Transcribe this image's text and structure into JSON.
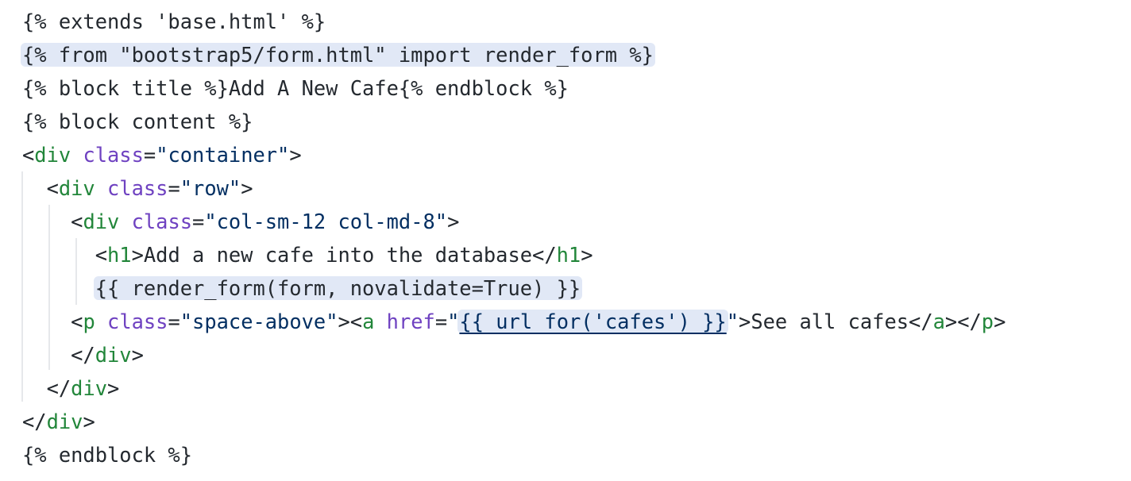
{
  "editor": {
    "colors": {
      "background": "#ffffff",
      "default_text": "#24292f",
      "tag": "#22863a",
      "attribute": "#6f42c1",
      "string": "#032f62",
      "highlight_background": "#e1e8f6",
      "indent_guide": "#e6e8eb"
    },
    "lines": [
      {
        "tokens": [
          {
            "text": "{% extends 'base.html' %}",
            "kind": "text"
          }
        ]
      },
      {
        "tokens": [
          {
            "text": "{% from \"bootstrap5/form.html\" import render_form %}",
            "kind": "text",
            "highlight": true
          }
        ]
      },
      {
        "tokens": [
          {
            "text": "{% block title %}Add A New Cafe{% endblock %}",
            "kind": "text"
          }
        ]
      },
      {
        "tokens": [
          {
            "text": "{% block content %}",
            "kind": "text"
          }
        ]
      },
      {
        "tokens": [
          {
            "text": "<",
            "kind": "text"
          },
          {
            "text": "div",
            "kind": "tag"
          },
          {
            "text": " ",
            "kind": "text"
          },
          {
            "text": "class",
            "kind": "attr"
          },
          {
            "text": "=",
            "kind": "text"
          },
          {
            "text": "\"container\"",
            "kind": "string"
          },
          {
            "text": ">",
            "kind": "text"
          }
        ]
      },
      {
        "tokens": [
          {
            "text": "  <",
            "kind": "text"
          },
          {
            "text": "div",
            "kind": "tag"
          },
          {
            "text": " ",
            "kind": "text"
          },
          {
            "text": "class",
            "kind": "attr"
          },
          {
            "text": "=",
            "kind": "text"
          },
          {
            "text": "\"row\"",
            "kind": "string"
          },
          {
            "text": ">",
            "kind": "text"
          }
        ]
      },
      {
        "tokens": [
          {
            "text": "    <",
            "kind": "text"
          },
          {
            "text": "div",
            "kind": "tag"
          },
          {
            "text": " ",
            "kind": "text"
          },
          {
            "text": "class",
            "kind": "attr"
          },
          {
            "text": "=",
            "kind": "text"
          },
          {
            "text": "\"col-sm-12 col-md-8\"",
            "kind": "string"
          },
          {
            "text": ">",
            "kind": "text"
          }
        ]
      },
      {
        "tokens": [
          {
            "text": "      <",
            "kind": "text"
          },
          {
            "text": "h1",
            "kind": "tag"
          },
          {
            "text": ">Add a new cafe into the database</",
            "kind": "text"
          },
          {
            "text": "h1",
            "kind": "tag"
          },
          {
            "text": ">",
            "kind": "text"
          }
        ]
      },
      {
        "tokens": [
          {
            "text": "      ",
            "kind": "text"
          },
          {
            "text": "{{ render_form(form, novalidate=True) }}",
            "kind": "text",
            "highlight": true
          }
        ]
      },
      {
        "tokens": [
          {
            "text": "    <",
            "kind": "text"
          },
          {
            "text": "p",
            "kind": "tag"
          },
          {
            "text": " ",
            "kind": "text"
          },
          {
            "text": "class",
            "kind": "attr"
          },
          {
            "text": "=",
            "kind": "text"
          },
          {
            "text": "\"space-above\"",
            "kind": "string"
          },
          {
            "text": "><",
            "kind": "text"
          },
          {
            "text": "a",
            "kind": "tag"
          },
          {
            "text": " ",
            "kind": "text"
          },
          {
            "text": "href",
            "kind": "attr"
          },
          {
            "text": "=",
            "kind": "text"
          },
          {
            "text": "\"",
            "kind": "string"
          },
          {
            "text": "{{ url_for('cafes') }}",
            "kind": "string",
            "highlight": true,
            "link": true
          },
          {
            "text": "\"",
            "kind": "string"
          },
          {
            "text": ">See all cafes</",
            "kind": "text"
          },
          {
            "text": "a",
            "kind": "tag"
          },
          {
            "text": "></",
            "kind": "text"
          },
          {
            "text": "p",
            "kind": "tag"
          },
          {
            "text": ">",
            "kind": "text"
          }
        ]
      },
      {
        "tokens": [
          {
            "text": "    </",
            "kind": "text"
          },
          {
            "text": "div",
            "kind": "tag"
          },
          {
            "text": ">",
            "kind": "text"
          }
        ]
      },
      {
        "tokens": [
          {
            "text": "  </",
            "kind": "text"
          },
          {
            "text": "div",
            "kind": "tag"
          },
          {
            "text": ">",
            "kind": "text"
          }
        ]
      },
      {
        "tokens": [
          {
            "text": "</",
            "kind": "text"
          },
          {
            "text": "div",
            "kind": "tag"
          },
          {
            "text": ">",
            "kind": "text"
          }
        ]
      },
      {
        "tokens": [
          {
            "text": "{% endblock %}",
            "kind": "text"
          }
        ]
      }
    ]
  }
}
